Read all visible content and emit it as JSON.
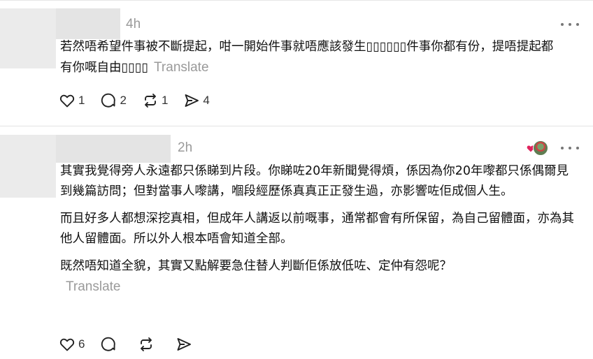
{
  "posts": [
    {
      "time": "4h",
      "paragraphs": [
        "若然唔希望件事被不斷提起，咁一開始件事就唔應該發生▯▯▯▯▯▯件事你都有份，提唔提起都有你嘅自由▯▯▯▯"
      ],
      "translate_label": "Translate",
      "likes": "1",
      "replies": "2",
      "reposts": "1",
      "shares": "4"
    },
    {
      "time": "2h",
      "paragraphs": [
        "其實我覺得旁人永遠都只係睇到片段。你睇咗20年新聞覺得煩，係因為你20年嚟都只係偶爾見到幾篇訪問；但對當事人嚟講，嗰段經歷係真真正正發生過，亦影響咗佢成個人生。",
        "而且好多人都想深挖真相，但成年人講返以前嘅事，通常都會有所保留，為自己留體面，亦為其他人留體面。所以外人根本唔會知道全部。",
        "既然唔知道全貌，其實又點解要急住替人判斷佢係放低咗、定仲有怨呢？"
      ],
      "translate_label": "Translate",
      "likes": "6",
      "replies": "",
      "reposts": "",
      "shares": ""
    }
  ],
  "icons": {
    "like": "heart-icon",
    "reply": "comment-icon",
    "repost": "repost-icon",
    "share": "send-icon",
    "more": "more-options-icon"
  }
}
